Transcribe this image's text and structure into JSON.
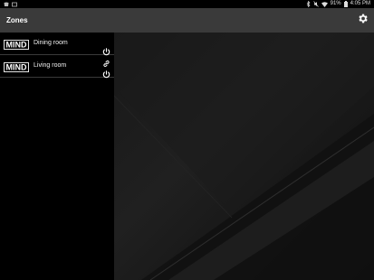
{
  "status_bar": {
    "battery": "91%",
    "time": "4:05 PM",
    "left_icons": [
      "notification-icon",
      "notification-icon"
    ],
    "right_icons": [
      "bluetooth-icon",
      "mute-icon",
      "wifi-icon",
      "battery-icon"
    ]
  },
  "app_bar": {
    "title": "Zones",
    "settings_icon": "gear-icon"
  },
  "zones": [
    {
      "logo": "MIND",
      "name": "Dining room",
      "icons": [
        "power-icon"
      ]
    },
    {
      "logo": "MIND",
      "name": "Living room",
      "icons": [
        "link-icon",
        "power-icon"
      ]
    }
  ],
  "colors": {
    "app_bar": "#3a3a3a",
    "background": "#000000",
    "text": "#ffffff"
  }
}
